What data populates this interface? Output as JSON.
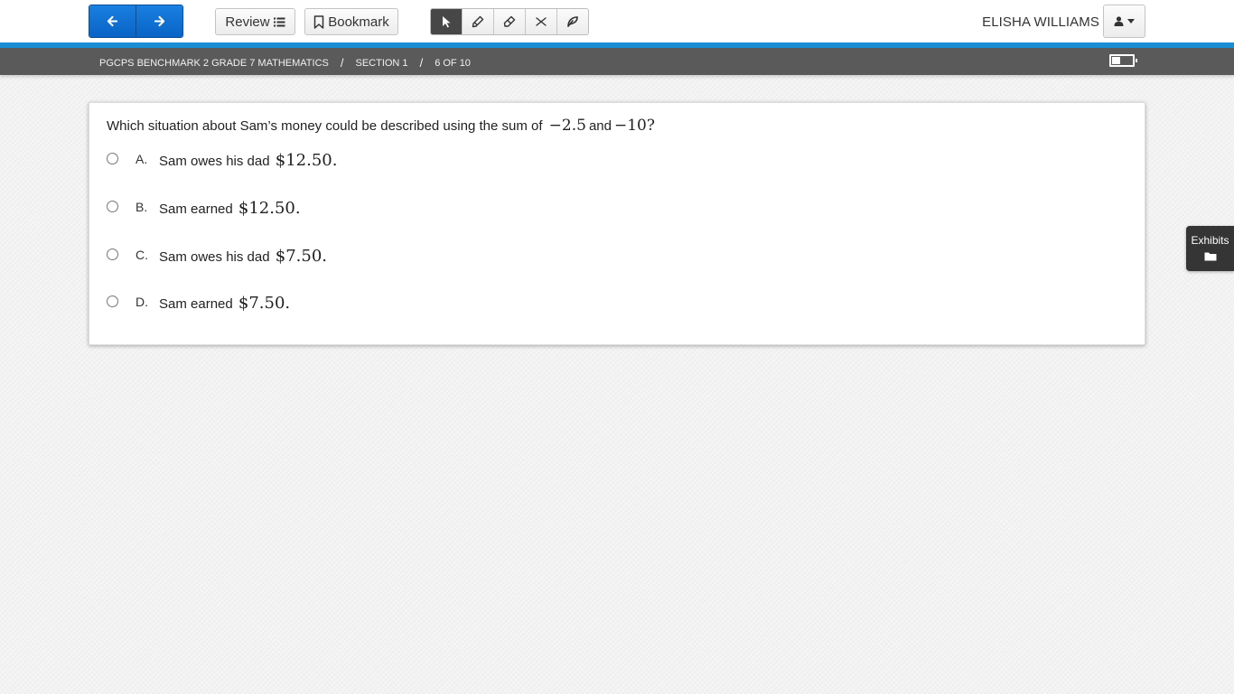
{
  "nav": {
    "back_icon": "arrow-left-icon",
    "next_icon": "arrow-right-icon"
  },
  "toolbar": {
    "review_label": "Review",
    "bookmark_label": "Bookmark",
    "tools": [
      {
        "name": "pointer-icon",
        "active": true
      },
      {
        "name": "highlighter-icon",
        "active": false
      },
      {
        "name": "eraser-icon",
        "active": false
      },
      {
        "name": "answer-eliminator-icon",
        "active": false
      },
      {
        "name": "line-reader-icon",
        "active": false
      }
    ]
  },
  "user": {
    "name": "ELISHA WILLIAMS",
    "menu_icon": "user-icon"
  },
  "breadcrumb": {
    "test": "PGCPS BENCHMARK 2 GRADE 7 MATHEMATICS",
    "separator": "/",
    "section": "SECTION 1",
    "position": "6 OF 10"
  },
  "question": {
    "stem_text": "Which situation about Sam’s money could be described using the sum of",
    "value1": "−2.5",
    "conjunction": "and",
    "value2": "−10?",
    "options": [
      {
        "letter": "A.",
        "text": "Sam owes his dad",
        "amount": "$12.50."
      },
      {
        "letter": "B.",
        "text": "Sam earned",
        "amount": "$12.50."
      },
      {
        "letter": "C.",
        "text": "Sam owes his dad",
        "amount": "$7.50."
      },
      {
        "letter": "D.",
        "text": "Sam earned",
        "amount": "$7.50."
      }
    ]
  },
  "exhibits": {
    "label": "Exhibits",
    "icon": "folder-icon"
  },
  "colors": {
    "primary": "#0864c6",
    "accent_line": "#1a8fd6",
    "breadcrumb_bg": "#5a5a5a"
  }
}
